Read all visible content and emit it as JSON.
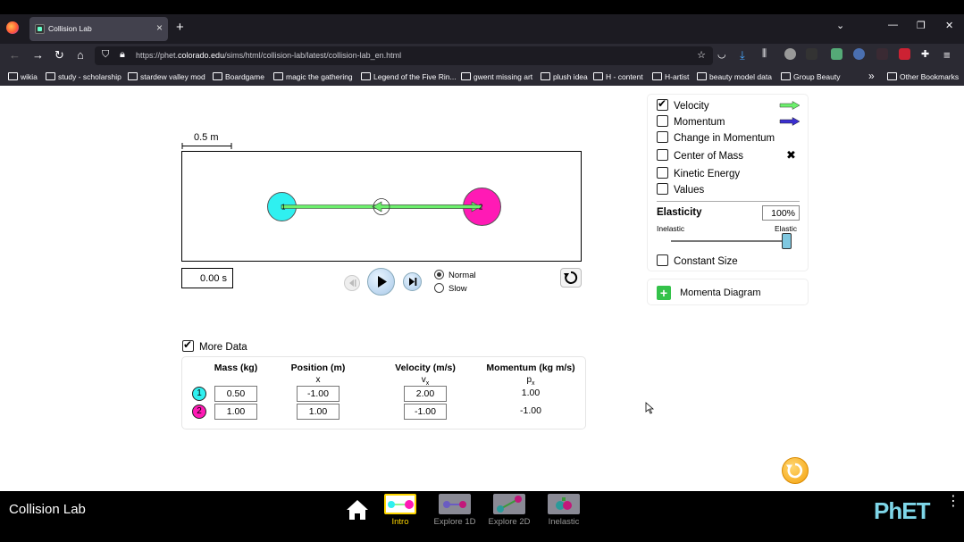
{
  "browser": {
    "tab_title": "Collision Lab",
    "new_tab_icon": "plus-icon",
    "url_prefix": "https://phet.",
    "url_domain": "colorado.edu",
    "url_path": "/sims/html/collision-lab/latest/collision-lab_en.html",
    "bookmarks": [
      "wikia",
      "study - scholarship",
      "stardew valley mod",
      "Boardgame",
      "magic the gathering",
      "Legend of the Five Rin...",
      "gwent missing art",
      "plush idea",
      "H - content",
      "H-artist",
      "beauty model data",
      "Group Beauty"
    ],
    "other_bookmarks": "Other Bookmarks",
    "overflow_label": "»"
  },
  "sim": {
    "scale_label": "0.5 m",
    "time": "0.00 s",
    "speed_options": [
      "Normal",
      "Slow"
    ],
    "selected_speed": "Normal",
    "ball_labels": [
      "1",
      "2"
    ],
    "colors": {
      "ball1": "#2ff0f0",
      "ball2": "#ff1ab5",
      "velocity": "#6cf06c",
      "momentum": "#3b2fd1"
    }
  },
  "controls": {
    "velocity": {
      "label": "Velocity",
      "checked": true
    },
    "momentum": {
      "label": "Momentum",
      "checked": false
    },
    "change_in_momentum": {
      "label": "Change in Momentum",
      "checked": false
    },
    "center_of_mass": {
      "label": "Center of Mass",
      "checked": false
    },
    "kinetic_energy": {
      "label": "Kinetic Energy",
      "checked": false
    },
    "values": {
      "label": "Values",
      "checked": false
    },
    "elasticity_label": "Elasticity",
    "elasticity_value": "100%",
    "elasticity_min_label": "Inelastic",
    "elasticity_max_label": "Elastic",
    "elasticity_fraction": 1.0,
    "constant_size": {
      "label": "Constant Size",
      "checked": false
    },
    "momenta_diagram": "Momenta Diagram"
  },
  "more_data": {
    "label": "More Data",
    "checked": true,
    "headers": {
      "mass": "Mass (kg)",
      "position": "Position (m)",
      "position_sub": "x",
      "velocity": "Velocity (m/s)",
      "velocity_sub": "v",
      "velocity_sub_idx": "x",
      "momentum": "Momentum (kg m/s)",
      "momentum_sub": "p",
      "momentum_sub_idx": "x"
    },
    "rows": [
      {
        "id": "1",
        "mass": "0.50",
        "position": "-1.00",
        "velocity": "2.00",
        "momentum": "1.00"
      },
      {
        "id": "2",
        "mass": "1.00",
        "position": "1.00",
        "velocity": "-1.00",
        "momentum": "-1.00"
      }
    ]
  },
  "footer": {
    "sim_title": "Collision Lab",
    "screens": [
      "Intro",
      "Explore 1D",
      "Explore 2D",
      "Inelastic"
    ],
    "selected_screen": "Intro",
    "brand": "PhET"
  }
}
